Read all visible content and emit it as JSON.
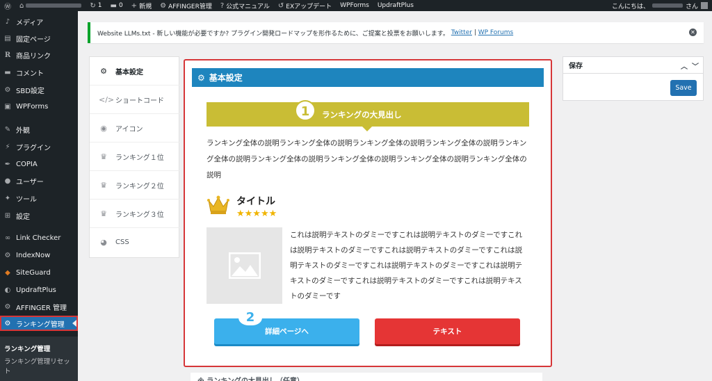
{
  "adminbar": {
    "updates": "1",
    "comments": "0",
    "new": "新規",
    "affinger": "AFFINGER管理",
    "manual": "公式マニュアル",
    "ex_update": "EXアップデート",
    "wpforms": "WPForms",
    "updraft": "UpdraftPlus",
    "greeting": "こんにちは、",
    "greeting_suffix": "さん"
  },
  "sidebar": {
    "items": [
      {
        "label": "メディア",
        "icon": "media-icon"
      },
      {
        "label": "固定ページ",
        "icon": "page-icon"
      },
      {
        "label": "商品リンク",
        "icon": "r-icon"
      },
      {
        "label": "コメント",
        "icon": "comment-icon"
      },
      {
        "label": "SBD設定",
        "icon": "gear-icon"
      },
      {
        "label": "WPForms",
        "icon": "form-icon"
      },
      {
        "label": "外観",
        "icon": "brush-icon"
      },
      {
        "label": "プラグイン",
        "icon": "plugin-icon"
      },
      {
        "label": "COPIA",
        "icon": "pen-icon"
      },
      {
        "label": "ユーザー",
        "icon": "user-icon"
      },
      {
        "label": "ツール",
        "icon": "wrench-icon"
      },
      {
        "label": "設定",
        "icon": "settings-icon"
      },
      {
        "label": "Link Checker",
        "icon": "link-icon"
      },
      {
        "label": "IndexNow",
        "icon": "gear-icon"
      },
      {
        "label": "SiteGuard",
        "icon": "shield-icon"
      },
      {
        "label": "UpdraftPlus",
        "icon": "updraft-icon"
      },
      {
        "label": "AFFINGER 管理",
        "icon": "gear-icon"
      },
      {
        "label": "ランキング管理",
        "icon": "gear-icon"
      }
    ],
    "submenu": [
      "ランキング管理",
      "ランキング管理リセット"
    ]
  },
  "notice": {
    "text": "Website LLMs.txt - 新しい機能が必要ですか? プラグイン開発ロードマップを形作るために、ご提案と投票をお願いします。",
    "link1": "Twitter",
    "sep": "|",
    "link2": "WP Forums"
  },
  "tabs": [
    {
      "label": "基本設定",
      "icon": "gear-icon"
    },
    {
      "label": "ショートコード",
      "icon": "code-icon"
    },
    {
      "label": "アイコン",
      "icon": "eye-icon"
    },
    {
      "label": "ランキング１位",
      "icon": "trophy-icon"
    },
    {
      "label": "ランキング２位",
      "icon": "trophy-icon"
    },
    {
      "label": "ランキング３位",
      "icon": "trophy-icon"
    },
    {
      "label": "CSS",
      "icon": "palette-icon"
    }
  ],
  "preview": {
    "header": "基本設定",
    "rank_number": "1",
    "rank_heading": "ランキングの大見出し",
    "rank_desc": "ランキング全体の説明ランキング全体の説明ランキング全体の説明ランキング全体の説明ランキング全体の説明ランキング全体の説明ランキング全体の説明ランキング全体の説明ランキング全体の説明",
    "title": "タイトル",
    "stars": "★★★★★",
    "item_desc": "これは説明テキストのダミーですこれは説明テキストのダミーですこれは説明テキストのダミーですこれは説明テキストのダミーですこれは説明テキストのダミーですこれは説明テキストのダミーですこれは説明テキストのダミーですこれは説明テキストのダミーですこれは説明テキストのダミーです",
    "detail_button": "詳細ページへ",
    "detail_number": "2",
    "text_button": "テキスト"
  },
  "bottom_heading": "※ ランキングの大見出し（任意）",
  "save": {
    "title": "保存",
    "button": "Save"
  },
  "colors": {
    "accent": "#1e85be",
    "rank_gold": "#c9bd35",
    "detail_blue": "#3bb0ec",
    "text_red": "#e53535"
  }
}
